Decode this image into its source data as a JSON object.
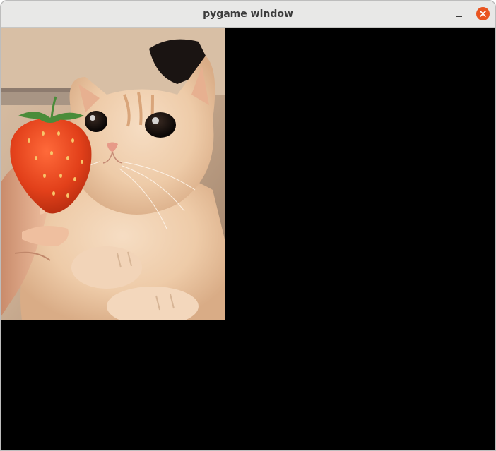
{
  "window": {
    "title": "pygame window",
    "controls": {
      "minimize_icon": "minimize-icon",
      "close_icon": "close-icon",
      "close_color": "#e95420"
    }
  },
  "canvas": {
    "background": "#000000",
    "sprite": {
      "subject": "cat-with-strawberry-photo"
    }
  }
}
